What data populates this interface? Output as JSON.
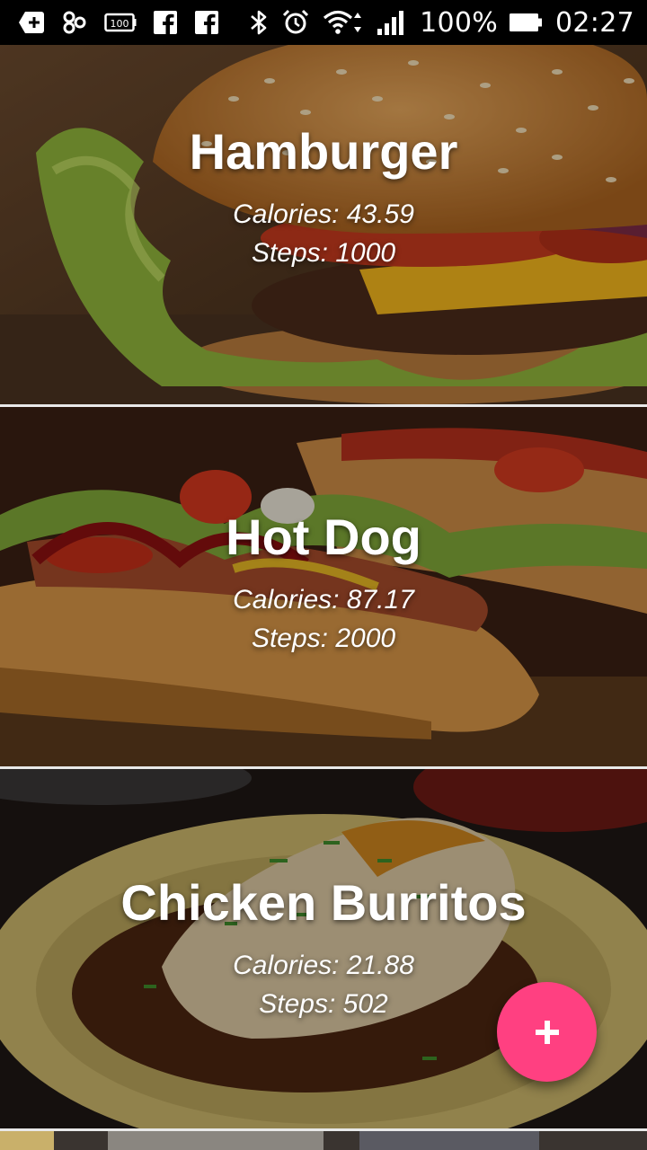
{
  "status_bar": {
    "battery_percent": "100%",
    "time": "02:27",
    "left_icons": [
      "add-box-icon",
      "link-icon",
      "battery-100-icon",
      "facebook-icon",
      "facebook-icon"
    ],
    "right_icons": [
      "bluetooth-icon",
      "alarm-icon",
      "wifi-icon",
      "signal-icon",
      "battery-icon"
    ]
  },
  "foods": [
    {
      "name": "Hamburger",
      "calories": "Calories: 43.59",
      "steps": "Steps: 1000"
    },
    {
      "name": "Hot Dog",
      "calories": "Calories: 87.17",
      "steps": "Steps: 2000"
    },
    {
      "name": "Chicken Burritos",
      "calories": "Calories: 21.88",
      "steps": "Steps: 502"
    }
  ],
  "fab": {
    "icon": "plus-icon",
    "color": "#ff4081"
  },
  "colors": {
    "accent": "#ff4081",
    "status_bar_bg": "#000000",
    "divider": "#e8e8e8"
  }
}
